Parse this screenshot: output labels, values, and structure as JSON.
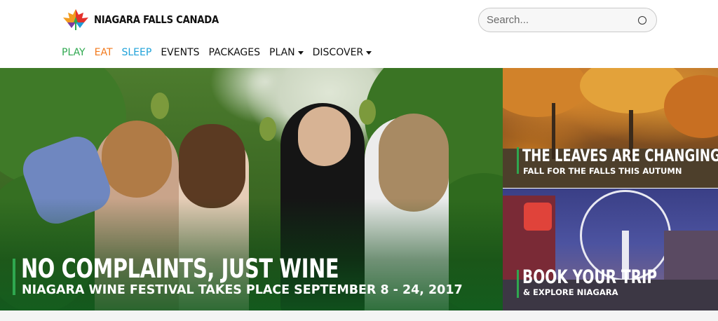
{
  "brand": {
    "name": "NIAGARA FALLS CANADA",
    "icon": "maple-leaf-logo-icon",
    "colors": [
      "#e4312b",
      "#f29c1f",
      "#2fa84f",
      "#1f9ad6",
      "#7a3fa0"
    ]
  },
  "search": {
    "placeholder": "Search...",
    "value": "",
    "icon": "search-icon"
  },
  "nav": {
    "items": [
      {
        "label": "PLAY",
        "color": "#2fa84f"
      },
      {
        "label": "EAT",
        "color": "#f27a1d"
      },
      {
        "label": "SLEEP",
        "color": "#1fa2d9"
      },
      {
        "label": "EVENTS",
        "color": "#111111"
      },
      {
        "label": "PACKAGES",
        "color": "#111111"
      },
      {
        "label": "PLAN",
        "color": "#111111",
        "dropdown": true
      },
      {
        "label": "DISCOVER",
        "color": "#111111",
        "dropdown": true
      }
    ]
  },
  "hero": {
    "title": "NO COMPLAINTS, JUST WINE",
    "subtitle": "NIAGARA WINE FESTIVAL TAKES PLACE SEPTEMBER 8 - 24, 2017",
    "accent": "#2fa84f"
  },
  "panels": {
    "autumn": {
      "title": "THE LEAVES ARE CHANGING",
      "subtitle": "FALL FOR THE FALLS THIS AUTUMN"
    },
    "trip": {
      "title": "BOOK YOUR TRIP",
      "subtitle": "& EXPLORE NIAGARA"
    }
  }
}
